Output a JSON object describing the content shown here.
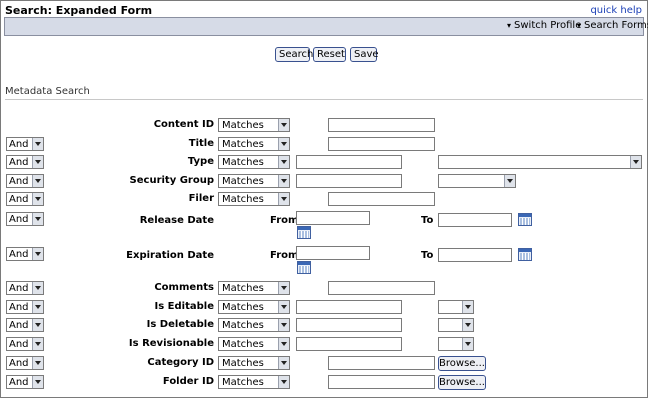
{
  "header": {
    "title": "Search: Expanded Form",
    "quick_help": "quick help"
  },
  "menu": {
    "switch_profile": "Switch Profile",
    "search_forms": "Search Forms"
  },
  "actions": {
    "search": "Search",
    "reset": "Reset",
    "save": "Save"
  },
  "section": {
    "label": "Metadata Search"
  },
  "connector": "And",
  "operator": "Matches",
  "fields": [
    {
      "label": "Content ID",
      "connector": false,
      "operator": true,
      "input": "short"
    },
    {
      "label": "Title",
      "connector": true,
      "operator": true,
      "input": "short"
    },
    {
      "label": "Type",
      "connector": true,
      "operator": true,
      "input": "long",
      "dropdown": "wide"
    },
    {
      "label": "Security Group",
      "connector": true,
      "operator": true,
      "input": "long",
      "dropdown": "medium"
    },
    {
      "label": "Filer",
      "connector": true,
      "operator": true,
      "input": "short"
    },
    {
      "label": "Release Date",
      "connector": true,
      "operator": false,
      "date": true
    },
    {
      "label": "Expiration Date",
      "connector": true,
      "operator": false,
      "date": true
    },
    {
      "label": "Comments",
      "connector": true,
      "operator": true,
      "input": "short"
    },
    {
      "label": "Is Editable",
      "connector": true,
      "operator": true,
      "input": "long",
      "dropdown": "small"
    },
    {
      "label": "Is Deletable",
      "connector": true,
      "operator": true,
      "input": "long",
      "dropdown": "small"
    },
    {
      "label": "Is Revisionable",
      "connector": true,
      "operator": true,
      "input": "long",
      "dropdown": "small"
    },
    {
      "label": "Category ID",
      "connector": true,
      "operator": true,
      "input": "short",
      "browse": true
    },
    {
      "label": "Folder ID",
      "connector": true,
      "operator": true,
      "input": "short",
      "browse": true
    }
  ],
  "date_labels": {
    "from": "From",
    "to": "To"
  },
  "browse_label": "Browse..."
}
